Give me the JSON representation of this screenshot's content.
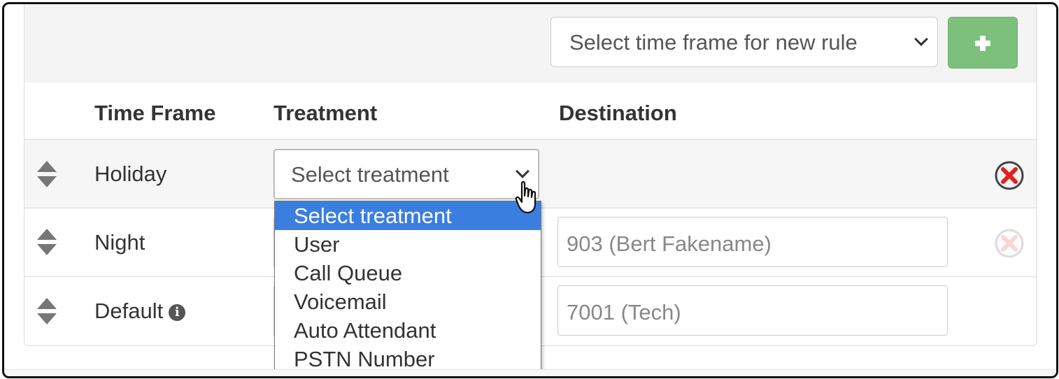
{
  "toolbar": {
    "time_frame_select_value": "Select time frame for new rule",
    "add_button_icon": "plus-icon",
    "add_button_color": "#7cc07c"
  },
  "table": {
    "headers": [
      "Time Frame",
      "Treatment",
      "Destination"
    ],
    "rows": [
      {
        "time_frame": "Holiday",
        "treatment": "Select treatment",
        "destination": "",
        "delete_enabled": true
      },
      {
        "time_frame": "Night",
        "treatment": "",
        "destination": "903 (Bert Fakename)",
        "delete_enabled": false
      },
      {
        "time_frame": "Default",
        "treatment": "",
        "destination": "7001 (Tech)",
        "delete_enabled": false,
        "has_info_icon": true
      }
    ]
  },
  "dropdown": {
    "options": [
      "Select treatment",
      "User",
      "Call Queue",
      "Voicemail",
      "Auto Attendant",
      "PSTN Number"
    ],
    "selected_index": 0,
    "selected_color": "#3a7ee0"
  },
  "icons": {
    "sort": "sort-arrows-icon",
    "delete": "delete-circle-x-icon",
    "info": "info-icon",
    "cursor": "hand-pointer-cursor-icon"
  },
  "colors": {
    "delete_red": "#e02020",
    "header_bg": "#f4f4f4"
  }
}
